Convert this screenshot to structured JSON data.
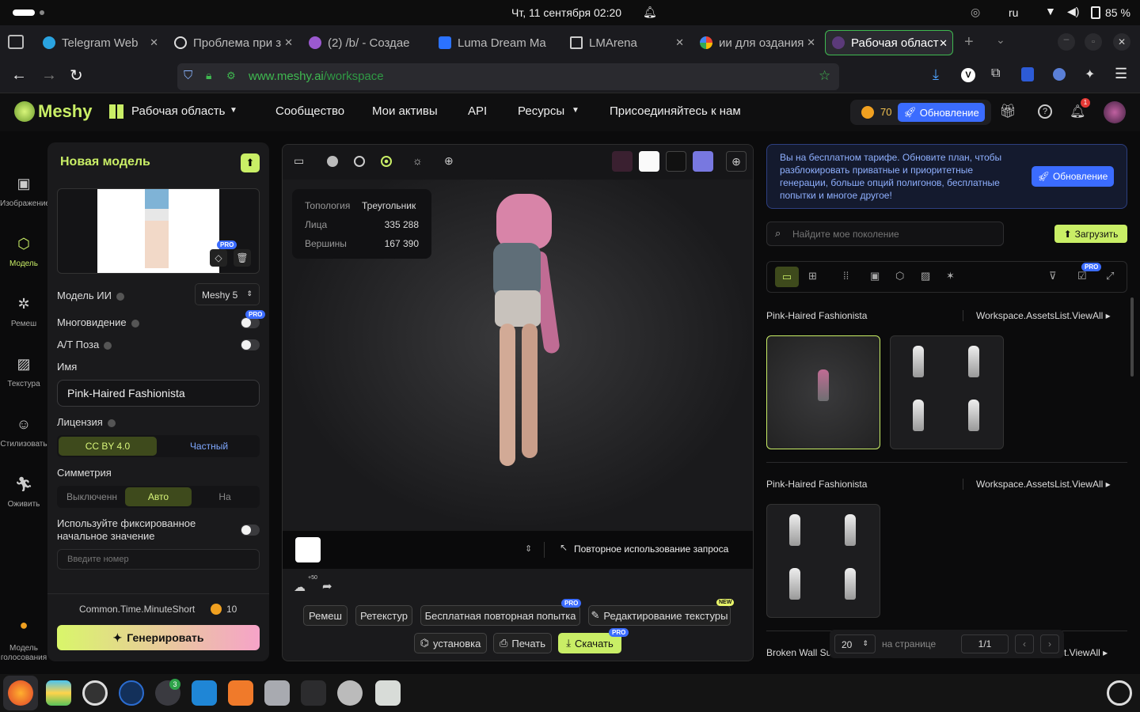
{
  "system": {
    "datetime": "Чт, 11 сентября  02:20",
    "lang": "ru",
    "battery": "85 %"
  },
  "tabs": [
    {
      "title": "Telegram Web",
      "color": "#2aa3e0"
    },
    {
      "title": "Проблема при з",
      "color": "#ffffff"
    },
    {
      "title": "(2) /b/ - Создае",
      "color": "#9b59d0"
    },
    {
      "title": "Luma Dream Ma",
      "color": "#2b72ff"
    },
    {
      "title": "LMArena",
      "color": "#cfcfcf"
    },
    {
      "title": "ии для оздания",
      "color": "#ea4335"
    },
    {
      "title": "Рабочая област",
      "color": "#5b3a7a"
    }
  ],
  "url": {
    "domain": "www.meshy.ai",
    "path": "/workspace"
  },
  "header": {
    "logo": "Meshy",
    "workspace": "Рабочая область",
    "community": "Сообщество",
    "assets": "Мои активы",
    "api": "API",
    "resources": "Ресурсы",
    "join": "Присоединяйтесь к нам",
    "credits": "70",
    "upgrade": "Обновление",
    "notif_count": "1"
  },
  "sidenav": [
    {
      "label": "Изображение",
      "icon": "image-ai-icon"
    },
    {
      "label": "Модель",
      "icon": "cube-icon"
    },
    {
      "label": "Ремеш",
      "icon": "remesh-icon"
    },
    {
      "label": "Текстура",
      "icon": "texture-icon"
    },
    {
      "label": "Стилизовать",
      "icon": "stylize-icon"
    },
    {
      "label": "Оживить",
      "icon": "animate-icon"
    },
    {
      "label": "Модель голосования",
      "icon": "vote-icon"
    }
  ],
  "left": {
    "title": "Новая модель",
    "ai_model_label": "Модель ИИ",
    "ai_model_value": "Meshy 5",
    "multiview": "Многовидение",
    "at_pose": "A/T Поза",
    "name_label": "Имя",
    "name_value": "Pink-Haired Fashionista",
    "license_label": "Лицензия",
    "license_cc": "CC BY 4.0",
    "license_private": "Частный",
    "symmetry_label": "Симметрия",
    "sym_off": "Выключенн",
    "sym_auto": "Авто",
    "sym_on": "На",
    "seed_label": "Используйте фиксированное начальное значение",
    "seed_placeholder": "Введите номер",
    "time": "Common.Time.MinuteShort",
    "cost": "10",
    "generate": "Генерировать",
    "pro": "PRO"
  },
  "viewer": {
    "topology_label": "Топология",
    "topology_value": "Треугольник",
    "faces_label": "Лица",
    "faces_value": "335 288",
    "verts_label": "Вершины",
    "verts_value": "167 390",
    "reuse": "Повторное использование запроса",
    "badge50": "+50",
    "remesh": "Ремеш",
    "retexture": "Ретекстур",
    "retry": "Бесплатная повторная попытка",
    "edit_texture": "Редактирование текстуры",
    "new": "NEW",
    "rig": "установка",
    "print": "Печать",
    "download": "Скачать"
  },
  "right": {
    "banner": "Вы на бесплатном тарифе. Обновите план, чтобы разблокировать приватные и приоритетные генерации, больше опций полигонов, бесплатные попытки и многое другое!",
    "banner_btn": "Обновление",
    "search_placeholder": "Найдите мое поколение",
    "upload": "Загрузить",
    "group1_title": "Pink-Haired Fashionista",
    "group1_viewall": "Workspace.AssetsList.ViewAll",
    "group2_title": "Pink-Haired Fashionista",
    "group2_viewall": "Workspace.AssetsList.ViewAll",
    "group3_title": "Broken Wall Su",
    "group3_viewall": "st.ViewAll",
    "per_page": "20",
    "per_page_label": "на странице",
    "page": "1/1"
  },
  "dock_badge": "3"
}
